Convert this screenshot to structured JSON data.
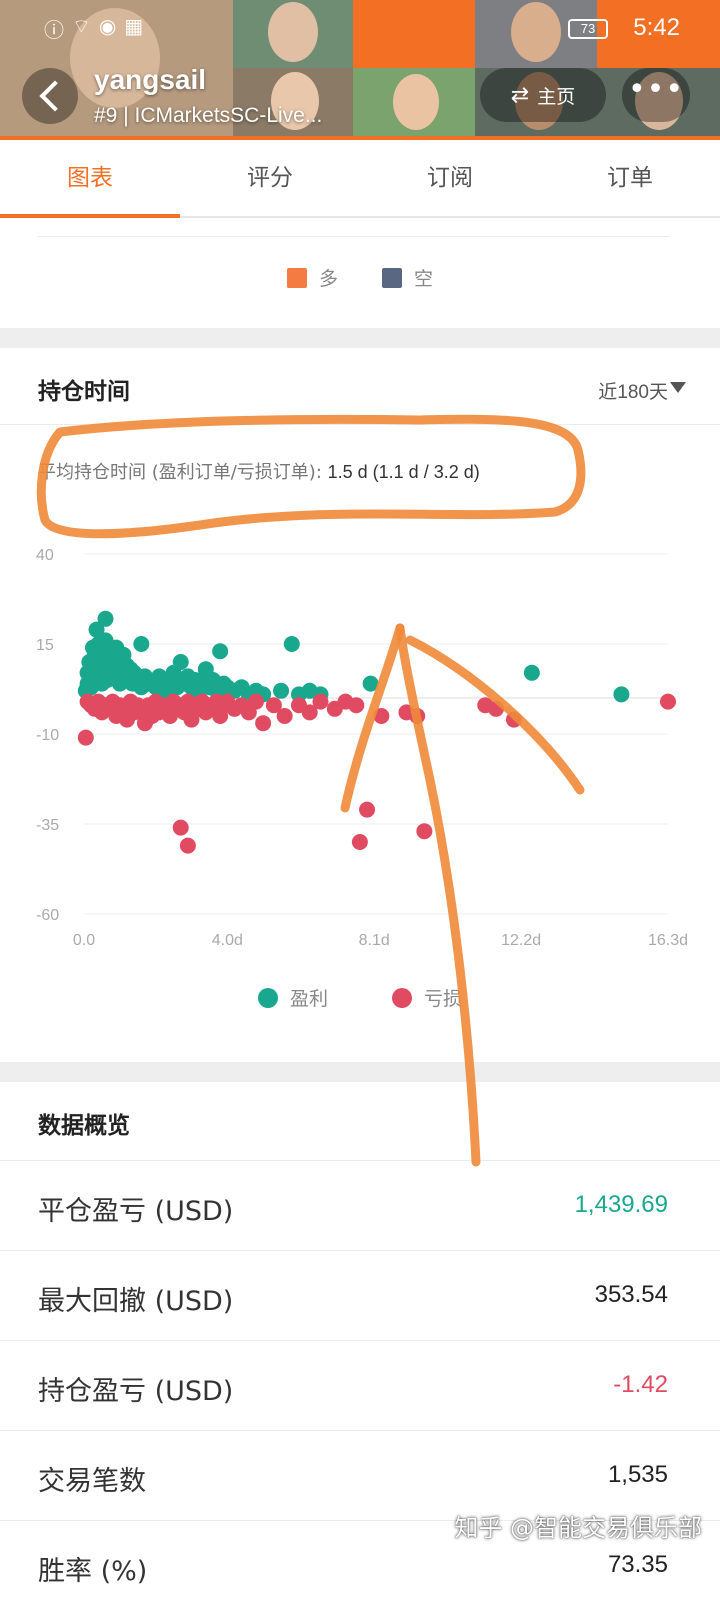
{
  "colors": {
    "accent": "#f36f24",
    "long": "#f47b42",
    "short": "#5a6782",
    "profit": "#19a88e",
    "loss": "#e04b62",
    "positive_text": "#19a88e",
    "negative_text": "#e04b62"
  },
  "status_bar": {
    "time": "5:42",
    "battery": "73"
  },
  "header": {
    "username": "yangsail",
    "subtitle": "#9 | ICMarketsSC-Live...",
    "home_label": "主页",
    "more_icon": "more-icon",
    "back_icon": "back-arrow-icon",
    "swap_icon": "swap-arrows-icon"
  },
  "tabs": [
    "图表",
    "评分",
    "订阅",
    "订单"
  ],
  "active_tab": 0,
  "direction_legend": {
    "long_label": "多",
    "short_label": "空"
  },
  "holding_time": {
    "title": "持仓时间",
    "period": "近180天",
    "avg_label": "平均持仓时间 (盈利订单/亏损订单): ",
    "avg_value": "1.5 d (1.1 d / 3.2 d)"
  },
  "chart_data": {
    "type": "scatter",
    "title": "",
    "xlabel": "",
    "ylabel": "",
    "x_unit": "d",
    "xlim": [
      0,
      16.3
    ],
    "ylim": [
      -60,
      40
    ],
    "x_ticks": [
      "0.0",
      "4.0d",
      "8.1d",
      "12.2d",
      "16.3d"
    ],
    "y_ticks": [
      "40",
      "15",
      "-10",
      "-35",
      "-60"
    ],
    "grid": true,
    "legend_position": "bottom",
    "series": [
      {
        "name": "盈利",
        "color": "#19a88e",
        "points": [
          [
            0.05,
            2
          ],
          [
            0.1,
            4
          ],
          [
            0.1,
            7
          ],
          [
            0.15,
            10
          ],
          [
            0.2,
            5
          ],
          [
            0.2,
            3
          ],
          [
            0.25,
            8
          ],
          [
            0.3,
            12
          ],
          [
            0.3,
            6
          ],
          [
            0.35,
            9
          ],
          [
            0.4,
            11
          ],
          [
            0.4,
            15
          ],
          [
            0.45,
            7
          ],
          [
            0.5,
            4
          ],
          [
            0.5,
            13
          ],
          [
            0.55,
            8
          ],
          [
            0.6,
            10
          ],
          [
            0.6,
            16
          ],
          [
            0.65,
            5
          ],
          [
            0.7,
            12
          ],
          [
            0.7,
            9
          ],
          [
            0.75,
            7
          ],
          [
            0.8,
            11
          ],
          [
            0.85,
            6
          ],
          [
            0.9,
            14
          ],
          [
            0.95,
            8
          ],
          [
            1.0,
            4
          ],
          [
            1.0,
            10
          ],
          [
            1.05,
            7
          ],
          [
            1.1,
            12
          ],
          [
            1.15,
            5
          ],
          [
            1.2,
            9
          ],
          [
            1.25,
            6
          ],
          [
            1.3,
            8
          ],
          [
            1.35,
            4
          ],
          [
            1.4,
            7
          ],
          [
            1.5,
            5
          ],
          [
            1.6,
            3
          ],
          [
            1.7,
            6
          ],
          [
            1.8,
            4
          ],
          [
            0.35,
            19
          ],
          [
            0.6,
            22
          ],
          [
            0.5,
            16
          ],
          [
            0.25,
            14
          ],
          [
            1.6,
            15
          ],
          [
            2.0,
            3
          ],
          [
            2.1,
            6
          ],
          [
            2.2,
            4
          ],
          [
            2.3,
            2
          ],
          [
            2.4,
            5
          ],
          [
            2.5,
            7
          ],
          [
            2.6,
            3
          ],
          [
            2.7,
            10
          ],
          [
            2.8,
            4
          ],
          [
            2.9,
            6
          ],
          [
            3.0,
            3
          ],
          [
            3.1,
            5
          ],
          [
            3.2,
            2
          ],
          [
            3.3,
            4
          ],
          [
            3.4,
            8
          ],
          [
            3.5,
            3
          ],
          [
            3.6,
            5
          ],
          [
            3.7,
            2
          ],
          [
            3.8,
            13
          ],
          [
            3.9,
            4
          ],
          [
            4.0,
            3
          ],
          [
            4.2,
            2
          ],
          [
            4.4,
            3
          ],
          [
            4.6,
            1
          ],
          [
            4.8,
            2
          ],
          [
            5.0,
            1
          ],
          [
            5.5,
            2
          ],
          [
            5.8,
            15
          ],
          [
            6.0,
            1
          ],
          [
            6.3,
            2
          ],
          [
            6.6,
            1
          ],
          [
            8.0,
            4
          ],
          [
            12.5,
            7
          ],
          [
            15.0,
            1
          ]
        ]
      },
      {
        "name": "亏损",
        "color": "#e04b62",
        "points": [
          [
            0.05,
            -11
          ],
          [
            0.1,
            -1
          ],
          [
            0.2,
            -2
          ],
          [
            0.3,
            -3
          ],
          [
            0.4,
            -1
          ],
          [
            0.5,
            -4
          ],
          [
            0.6,
            -2
          ],
          [
            0.7,
            -3
          ],
          [
            0.8,
            -1
          ],
          [
            0.9,
            -5
          ],
          [
            1.0,
            -2
          ],
          [
            1.1,
            -3
          ],
          [
            1.2,
            -6
          ],
          [
            1.3,
            -1
          ],
          [
            1.4,
            -4
          ],
          [
            1.5,
            -2
          ],
          [
            1.6,
            -3
          ],
          [
            1.7,
            -7
          ],
          [
            1.8,
            -2
          ],
          [
            1.9,
            -5
          ],
          [
            2.0,
            -1
          ],
          [
            2.1,
            -4
          ],
          [
            2.2,
            -3
          ],
          [
            2.3,
            -2
          ],
          [
            2.4,
            -5
          ],
          [
            2.5,
            -1
          ],
          [
            2.6,
            -3
          ],
          [
            2.7,
            -2
          ],
          [
            2.8,
            -4
          ],
          [
            2.9,
            -1
          ],
          [
            3.0,
            -6
          ],
          [
            3.1,
            -2
          ],
          [
            3.2,
            -3
          ],
          [
            3.3,
            -1
          ],
          [
            3.4,
            -4
          ],
          [
            3.5,
            -2
          ],
          [
            3.6,
            -3
          ],
          [
            3.7,
            -1
          ],
          [
            3.8,
            -5
          ],
          [
            3.9,
            -2
          ],
          [
            4.0,
            -1
          ],
          [
            4.2,
            -3
          ],
          [
            4.4,
            -2
          ],
          [
            4.6,
            -4
          ],
          [
            4.8,
            -1
          ],
          [
            5.0,
            -7
          ],
          [
            5.3,
            -2
          ],
          [
            5.6,
            -5
          ],
          [
            6.0,
            -2
          ],
          [
            6.3,
            -4
          ],
          [
            6.6,
            -1
          ],
          [
            7.0,
            -3
          ],
          [
            7.3,
            -1
          ],
          [
            7.6,
            -2
          ],
          [
            8.3,
            -5
          ],
          [
            9.0,
            -4
          ],
          [
            9.3,
            -5
          ],
          [
            11.2,
            -2
          ],
          [
            11.5,
            -3
          ],
          [
            12.0,
            -6
          ],
          [
            16.3,
            -1
          ],
          [
            2.7,
            -36
          ],
          [
            2.9,
            -41
          ],
          [
            7.7,
            -40
          ],
          [
            7.9,
            -31
          ],
          [
            9.5,
            -37
          ]
        ]
      }
    ]
  },
  "overview": {
    "title": "数据概览",
    "rows": [
      {
        "label": "平仓盈亏 (USD)",
        "value": "1,439.69",
        "tone": "positive"
      },
      {
        "label": "最大回撤 (USD)",
        "value": "353.54",
        "tone": "neutral"
      },
      {
        "label": "持仓盈亏 (USD)",
        "value": "-1.42",
        "tone": "negative"
      },
      {
        "label": "交易笔数",
        "value": "1,535",
        "tone": "neutral"
      },
      {
        "label": "胜率 (%)",
        "value": "73.35",
        "tone": "neutral"
      }
    ]
  },
  "watermark": "知乎 @智能交易俱乐部"
}
